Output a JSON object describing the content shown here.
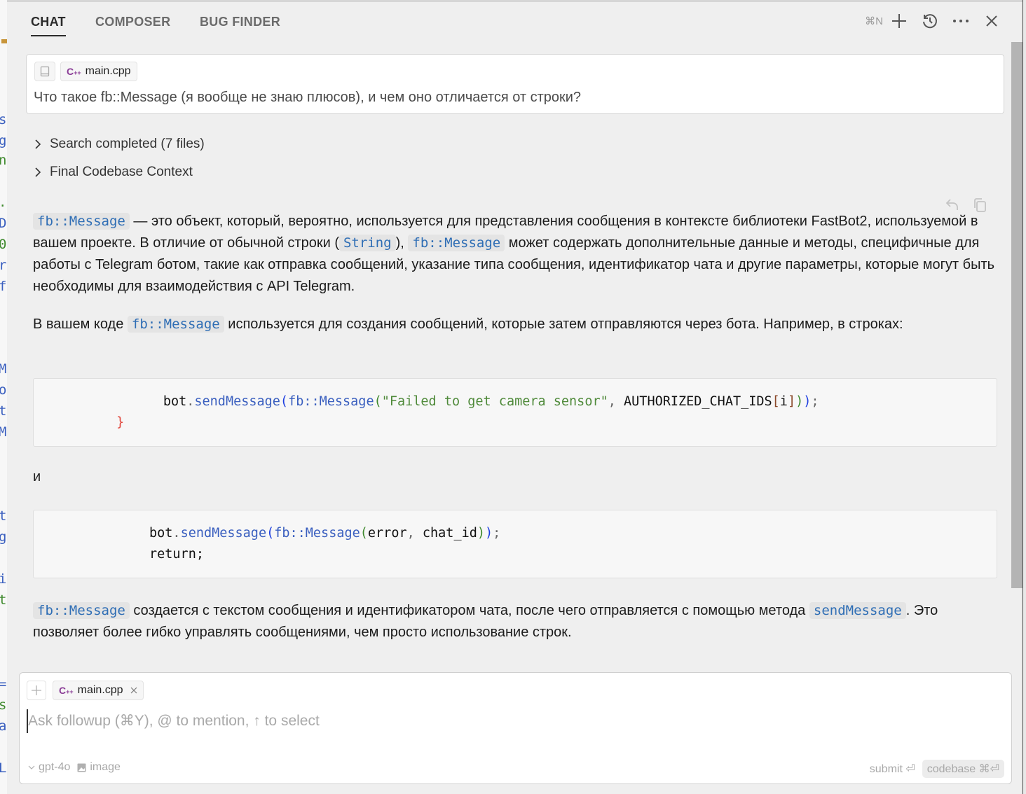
{
  "tabs": [
    {
      "label": "CHAT",
      "active": true
    },
    {
      "label": "COMPOSER",
      "active": false
    },
    {
      "label": "BUG FINDER",
      "active": false
    }
  ],
  "header_actions": {
    "new_chat_shortcut": "⌘N",
    "icons": [
      "plus-icon",
      "history-icon",
      "more-icon",
      "close-icon"
    ]
  },
  "question": {
    "context_file": "main.cpp",
    "file_icon_label": "C++",
    "text": "Что такое fb::Message (я вообще не знаю плюсов), и чем оно отличается от строки?"
  },
  "collapsibles": [
    {
      "label": "Search completed (7 files)"
    },
    {
      "label": "Final Codebase Context"
    }
  ],
  "answer": {
    "p1": {
      "code1": "fb::Message",
      "t1": " — это объект, который, вероятно, используется для представления сообщения в контексте библиотеки FastBot2, используемой в вашем проекте. В отличие от обычной строки (",
      "code2": "String",
      "t2": "), ",
      "code3": "fb::Message",
      "t3": " может содержать дополнительные данные и методы, специфичные для работы с Telegram ботом, такие как отправка сообщений, указание типа сообщения, идентификатор чата и другие параметры, которые могут быть необходимы для взаимодействия с API Telegram."
    },
    "p2": {
      "t1": "В вашем коде ",
      "code1": "fb::Message",
      "t2": " используется для создания сообщений, которые затем отправляются через бота. Например, в строках:"
    },
    "code_block_1": {
      "obj": "bot",
      "dot": ".",
      "method": "sendMessage",
      "open1": "(",
      "cls": "fb::Message",
      "open2": "(",
      "str": "\"Failed to get camera sensor\"",
      "comma": ", ",
      "arg": "AUTHORIZED_CHAT_IDS",
      "lb": "[",
      "idx": "i",
      "rb": "]",
      "close2": ")",
      "close1": ")",
      "semi": ";",
      "brace": "}"
    },
    "conjunction": "и",
    "code_block_2": {
      "obj": "bot",
      "dot": ".",
      "method": "sendMessage",
      "open1": "(",
      "cls": "fb::Message",
      "open2": "(",
      "arg1": "error",
      "comma": ", ",
      "arg2": "chat_id",
      "close2": ")",
      "close1": ")",
      "semi": ";",
      "line2": "return;"
    },
    "p3": {
      "code1": "fb::Message",
      "t1": " создается с текстом сообщения и идентификатором чата, после чего отправляется с помощью метода ",
      "code2": "sendMessage",
      "t2": ". Это позволяет более гибко управлять сообщениями, чем просто использование строк."
    }
  },
  "composer": {
    "context_file": "main.cpp",
    "file_icon_label": "C++",
    "placeholder": "Ask followup (⌘Y), @ to mention, ↑ to select",
    "value": "",
    "model": "gpt-4o",
    "image_label": "image",
    "submit_label": "submit ⏎",
    "codebase_label": "codebase ⌘⏎"
  }
}
